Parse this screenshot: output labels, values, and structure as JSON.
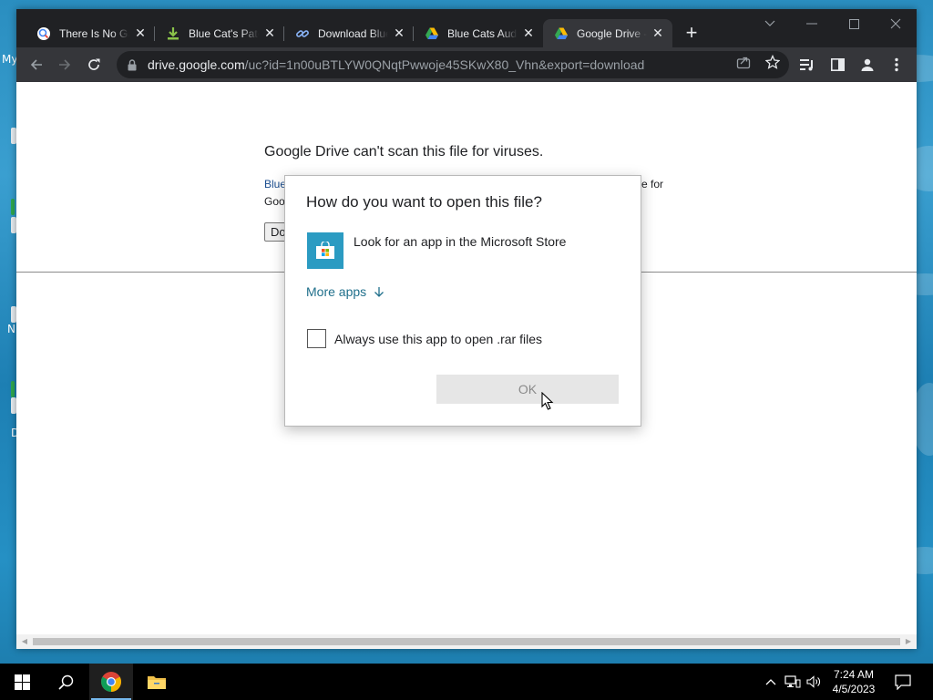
{
  "desktop": {
    "fragments": [
      "My",
      "N",
      "D"
    ]
  },
  "browser": {
    "tabs": [
      {
        "label": "There Is No Game",
        "icon": "search-favicon-icon",
        "active": false
      },
      {
        "label": "Blue Cat's Patch",
        "icon": "download-favicon-icon",
        "active": false
      },
      {
        "label": "Download Blue",
        "icon": "link-favicon-icon",
        "active": false
      },
      {
        "label": "Blue Cats Audio",
        "icon": "google-drive-favicon-icon",
        "active": false
      },
      {
        "label": "Google Drive - Virus scan warning",
        "icon": "google-drive-favicon-icon",
        "active": true
      }
    ],
    "url_host": "drive.google.com",
    "url_path": "/uc?id=1n00uBTLYW0QNqtPwwoje45SKwX80_Vhn&export=download"
  },
  "page": {
    "warning_title": "Google Drive can't scan this file for viruses.",
    "line1_left": "Blue",
    "line1_right": "e for",
    "line2_left": "Goo",
    "download_button": "Download anyway"
  },
  "dialog": {
    "title": "How do you want to open this file?",
    "store_option": "Look for an app in the Microsoft Store",
    "more_apps": "More apps",
    "always_use": "Always use this app to open .rar files",
    "always_checked": false,
    "ok": "OK"
  },
  "taskbar": {
    "time": "7:24 AM",
    "date": "4/5/2023"
  },
  "colors": {
    "chrome_dark": "#202124",
    "chrome_toolbar": "#35363a",
    "link_teal": "#1f6f8b",
    "store_tile": "#2b9bc2"
  }
}
